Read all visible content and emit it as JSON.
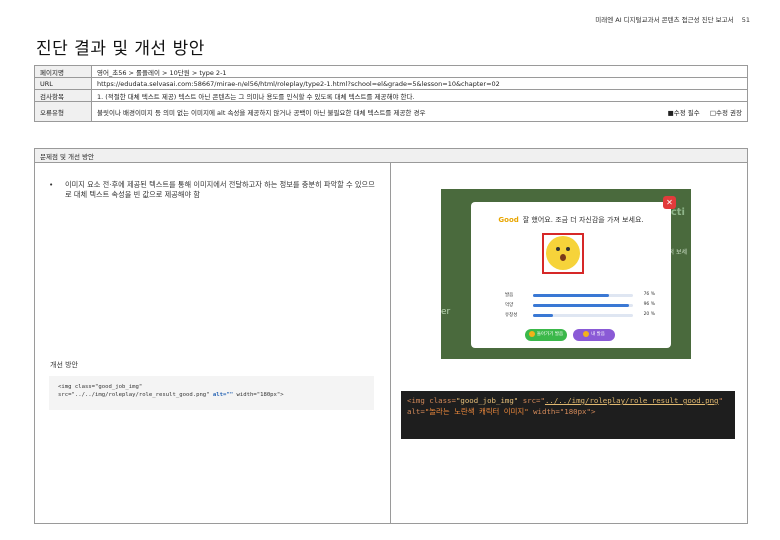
{
  "header": {
    "report_title": "미래엔 AI 디지털교과서 콘텐츠 접근성 진단 보고서",
    "page_number": "51"
  },
  "page_title": "진단 결과 및 개선 방안",
  "info_table": {
    "page_name_label": "페이지명",
    "page_name_value": "영어_초56 > 롤플레이 > 10단원 > type 2-1",
    "url_label": "URL",
    "url_value": "https://edudata.selvasai.com:58667/mirae-n/el56/html/roleplay/type2-1.html?school=el&grade=5&lesson=10&chapter=02",
    "check_label": "검사항목",
    "check_value": "1. (적절한 대체 텍스트 제공) 텍스트 아닌 콘텐츠는 그 의미나 용도를 인식할 수 있도록 대체 텍스트를 제공해야 한다.",
    "error_label": "오류유형",
    "error_value": "불릿이나 배경이미지 등 의미 없는 이미지에 alt 속성을 제공하지 않거나 공백이 아닌 불필요한 대체 텍스트를 제공한 경우",
    "required_label": "■수정 필수",
    "recommended_label": "□수정 권장"
  },
  "problem": {
    "header": "문제점 및 개선 방안",
    "bullet_text": "이미지 요소 전·후에 제공된 텍스트를 통해 이미지에서 전달하고자 하는 정보를 충분히 파악할 수 있으므로 대체 텍스트 속성을 빈 값으로 제공해야 함",
    "improve_label": "개선 방안",
    "code_line1": "<img class=\"good_job_img\"",
    "code_line2_pre": "src=\"../../img/roleplay/role_result_good.png\" ",
    "code_line2_attr": "alt=\"\"",
    "code_line2_post": " width=\"180px\">"
  },
  "screenshot": {
    "bg_text_right": "icti",
    "bg_text_side": "적 보세",
    "bg_text_left": "er",
    "good_label": "Good",
    "modal_message": "잘 했어요. 조금 더 자신감을 가져 보세요.",
    "close_glyph": "✕",
    "scores": [
      {
        "label": "발음",
        "value": 76,
        "pct_text": "76 %"
      },
      {
        "label": "억양",
        "value": 96,
        "pct_text": "96 %"
      },
      {
        "label": "유창성",
        "value": 20,
        "pct_text": "20 %"
      }
    ],
    "retry_button": "돌아가기 발음",
    "mine_button": "내 발음"
  },
  "original_code": {
    "p1": "<img class=",
    "p2": "\"good_job_img\"",
    "p3": " src=\"",
    "p4": "../../img/roleplay/role_result_good.png",
    "p5": "\" alt=",
    "p6": "\"놀라는 노란색 캐릭터 이미지\"",
    "p7": " width=\"180px\">"
  },
  "colors": {
    "accent_good": "#e8a500",
    "highlight_red": "#d62828",
    "code_bg": "#1e1e1e",
    "attr_blue": "#2a66b5"
  }
}
